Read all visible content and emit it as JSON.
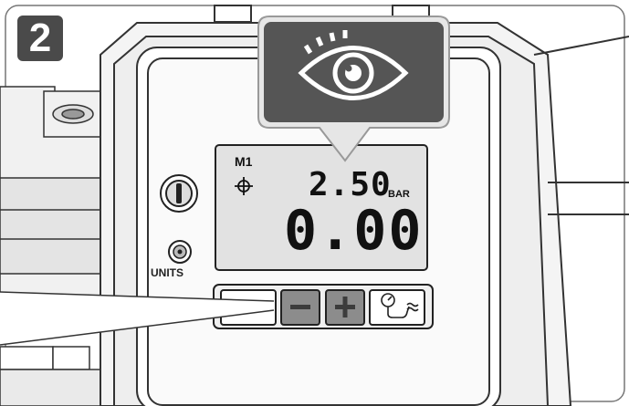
{
  "step": {
    "number": "2"
  },
  "callout": {
    "icon": "eye-icon"
  },
  "display": {
    "mode": "M1",
    "target_icon": "crosshair-icon",
    "set_value": "2.50",
    "unit": "BAR",
    "actual_value": "0.00"
  },
  "controls": {
    "power_icon": "power-icon",
    "units_label": "UNITS",
    "minus_icon": "minus-icon",
    "plus_icon": "plus-icon",
    "inflate_icon": "gauge-hose-icon"
  },
  "colors": {
    "badge": "#4a4a4a",
    "callout": "#555555",
    "button_gray": "#8c8c8c",
    "lcd": "#e2e2e2"
  }
}
